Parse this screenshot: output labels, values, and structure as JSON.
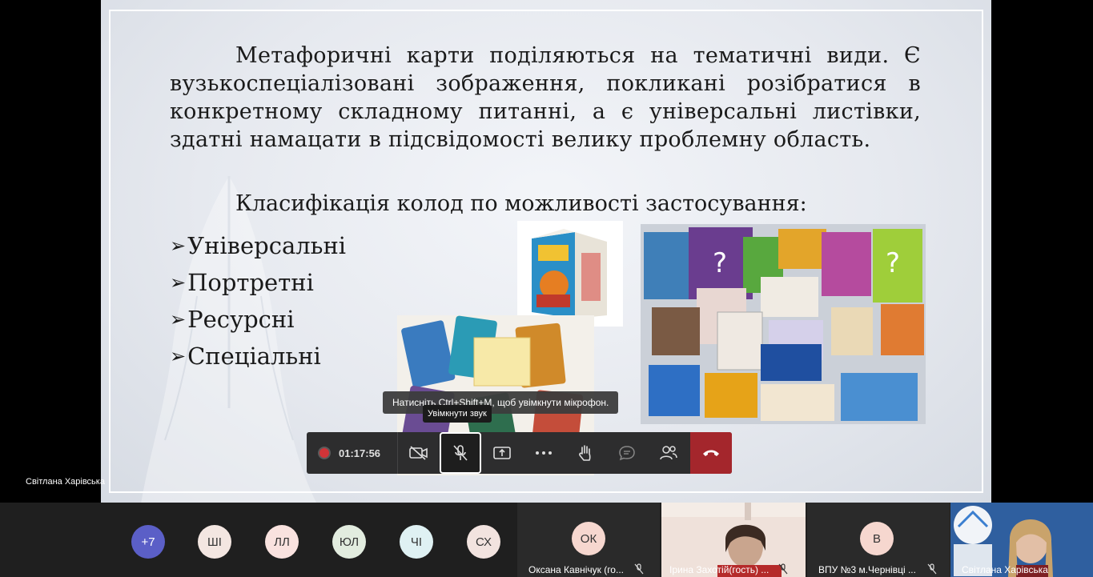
{
  "slide": {
    "paragraph": "Метафоричні карти поділяються на тематичні види. Є вузькоспеціалізовані зображення, покликані розібратися в конкретному складному питанні, а є універсальні листівки, здатні намацати в підсвідомості велику проблемну область.",
    "heading": "Класифікація колод по можливості застосування:",
    "bullets": [
      "Універсальні",
      "Портретні",
      "Ресурсні",
      "Спеціальні"
    ]
  },
  "controls": {
    "timer": "01:17:56"
  },
  "tooltips": {
    "shortcut_hint": "Натисніть Ctrl+Shift+M, щоб увімкнути мікрофон.",
    "unmute": "Увімкнути звук"
  },
  "presenter": {
    "name": "Світлана Харівська"
  },
  "strip": {
    "overflow": "+7",
    "avatars": [
      "ШІ",
      "ЛЛ",
      "ЮЛ",
      "ЧІ",
      "СХ"
    ]
  },
  "tiles": [
    {
      "initials": "ОК",
      "name": "Оксана Кавнічук (го..."
    },
    {
      "name": "Ірина Захотій(гость) ..."
    },
    {
      "initials": "В",
      "name": "ВПУ №3 м.Чернівці ..."
    },
    {
      "name": "Світлана Харівська"
    }
  ],
  "colors": {
    "leave_button": "#a4262c",
    "overflow_badge": "#5b5fc7",
    "record_dot": "#d13438"
  }
}
